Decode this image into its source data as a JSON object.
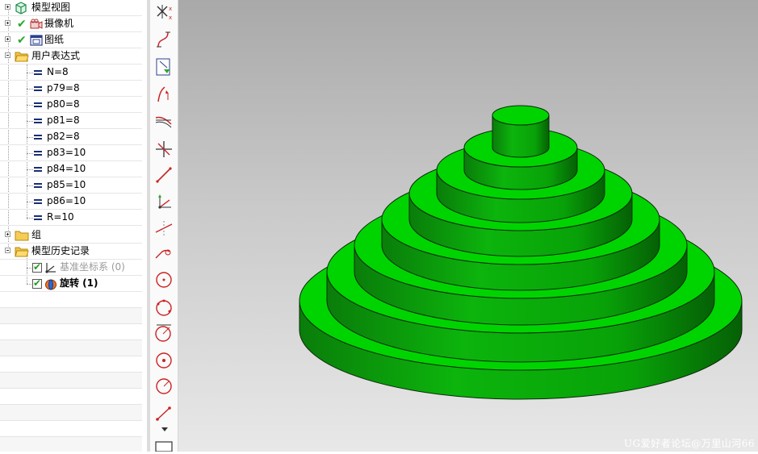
{
  "part_navigator": {
    "nodes": {
      "model_views": "模型视图",
      "cameras": "摄像机",
      "drawings": "图纸",
      "user_expressions": "用户表达式",
      "groups": "组",
      "model_history": "模型历史记录"
    },
    "expressions": [
      "N=8",
      "p79=8",
      "p80=8",
      "p81=8",
      "p82=8",
      "p83=10",
      "p84=10",
      "p85=10",
      "p86=10",
      "R=10"
    ],
    "history": [
      {
        "label": "基准坐标系 (0)",
        "checked": true,
        "icon": "datum-csys-icon",
        "active": false
      },
      {
        "label": "旋转 (1)",
        "checked": true,
        "icon": "revolve-icon",
        "active": true
      }
    ]
  },
  "toolbar": {
    "tools": [
      "point-set-icon",
      "curve-icon",
      "curve-arrow-icon",
      "spline-icon",
      "offset-curve-icon",
      "intersection-icon",
      "line-icon",
      "datum-axis-icon",
      "line-two-points-icon",
      "fillet-icon",
      "circle-center-icon",
      "circle-three-point-icon",
      "circle-tangent-icon",
      "circle-dot-icon",
      "circle-radius-icon",
      "line-endpoints-icon",
      "rectangle-icon"
    ]
  },
  "viewport": {
    "model_color": "#00d400",
    "watermark": "UG爱好者论坛@万里山河66"
  }
}
